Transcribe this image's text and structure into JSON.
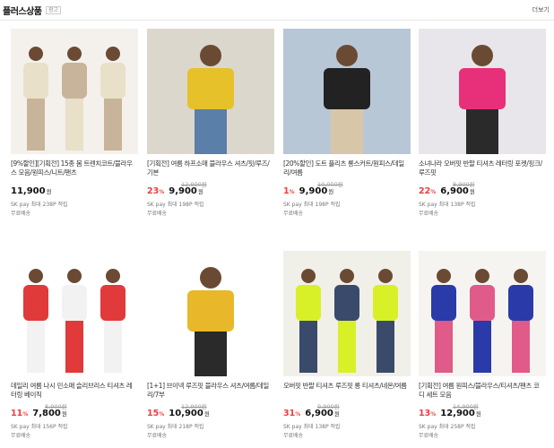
{
  "header": {
    "title": "플러스상품",
    "ad_badge": "광고",
    "more": "더보기"
  },
  "products": [
    {
      "name": "[9%할인][기획전] 15종 봄 트렌치코트/블라우스 모음/원피스/니트/팬츠",
      "original_price": "",
      "discount": "",
      "price": "11,900",
      "currency": "원",
      "pay": "SK pay 최대 238P 적립",
      "shipping": "무료배송",
      "colors": {
        "bg": "#f4f1ec",
        "a": "#e8e0c8",
        "b": "#c8b49a"
      }
    },
    {
      "name": "[기획전] 여름 하프소매 블라우스 셔츠/핏/루즈/기본",
      "original_price": "12,900원",
      "discount": "23",
      "price": "9,900",
      "currency": "원",
      "pay": "SK pay 최대 198P 적립",
      "shipping": "무료배송",
      "colors": {
        "bg": "#dcd7cc",
        "a": "#e6c12a",
        "b": "#5a7fa8"
      }
    },
    {
      "name": "[20%할인] 도트 플리츠 롱스커트/원피스/데일리/여름",
      "original_price": "10,000원",
      "discount": "1",
      "price": "9,900",
      "currency": "원",
      "pay": "SK pay 최대 198P 적립",
      "shipping": "무료배송",
      "colors": {
        "bg": "#b8c7d6",
        "a": "#222222",
        "b": "#d8c6a8"
      }
    },
    {
      "name": "소녀나라 오버핏 반팔 티셔츠 레터링 포켓/핑크/루즈핏",
      "original_price": "8,900원",
      "discount": "22",
      "price": "6,900",
      "currency": "원",
      "pay": "SK pay 최대 138P 적립",
      "shipping": "무료배송",
      "colors": {
        "bg": "#e8e6ea",
        "a": "#e8307a",
        "b": "#2a2a2a"
      }
    },
    {
      "name": "데일리 여름 나시 민소매 슬리브리스 티셔츠 레터링 베이직",
      "original_price": "8,900원",
      "discount": "11",
      "price": "7,800",
      "currency": "원",
      "pay": "SK pay 최대 156P 적립",
      "shipping": "무료배송",
      "colors": {
        "bg": "#ffffff",
        "a": "#e03a3a",
        "b": "#f2f2f2"
      }
    },
    {
      "name": "[1+1] 브이넥 루즈핏 블라우스 셔츠/여름/데일리/7부",
      "original_price": "12,900원",
      "discount": "15",
      "price": "10,900",
      "currency": "원",
      "pay": "SK pay 최대 218P 적립",
      "shipping": "무료배송",
      "colors": {
        "bg": "#ffffff",
        "a": "#e8b82a",
        "b": "#2a2a2a"
      }
    },
    {
      "name": "오버핏 반팔 티셔츠 루즈핏 롱 티셔츠/네온/여름",
      "original_price": "9,900원",
      "discount": "31",
      "price": "6,900",
      "currency": "원",
      "pay": "SK pay 최대 138P 적립",
      "shipping": "무료배송",
      "colors": {
        "bg": "#f0efe8",
        "a": "#d8f028",
        "b": "#3a4a6a"
      }
    },
    {
      "name": "[기획전] 여름 원피스/블라우스/티셔츠/팬츠 코디 세트 모음",
      "original_price": "14,900원",
      "discount": "13",
      "price": "12,900",
      "currency": "원",
      "pay": "SK pay 최대 258P 적립",
      "shipping": "무료배송",
      "colors": {
        "bg": "#f6f4f0",
        "a": "#2a3aa8",
        "b": "#e05a8a"
      }
    }
  ]
}
